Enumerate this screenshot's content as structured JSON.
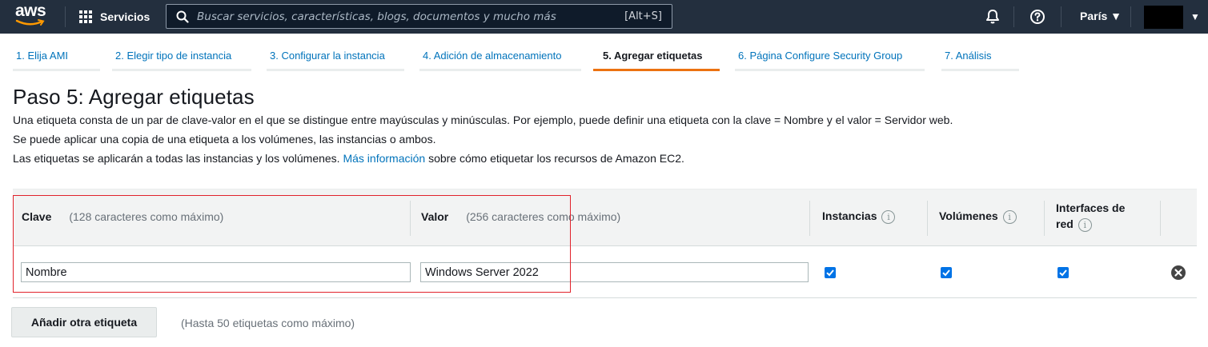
{
  "topnav": {
    "logo_text": "aws",
    "services_label": "Servicios",
    "search_placeholder": "Buscar servicios, características, blogs, documentos y mucho más",
    "search_shortcut": "[Alt+S]",
    "region_label": "París ▼",
    "account_caret": "▼",
    "bg_color": "#232f3e"
  },
  "wizard": {
    "tabs": [
      {
        "label": "1. Elija AMI",
        "active": false
      },
      {
        "label": "2. Elegir tipo de instancia",
        "active": false
      },
      {
        "label": "3. Configurar la instancia",
        "active": false
      },
      {
        "label": "4. Adición de almacenamiento",
        "active": false
      },
      {
        "label": "5. Agregar etiquetas",
        "active": true
      },
      {
        "label": "6. Página Configure Security Group",
        "active": false
      },
      {
        "label": "7. Análisis",
        "active": false
      }
    ],
    "active_color": "#ec7211"
  },
  "page": {
    "title": "Paso 5: Agregar etiquetas",
    "desc1": "Una etiqueta consta de un par de clave-valor en el que se distingue entre mayúsculas y minúsculas. Por ejemplo, puede definir una etiqueta con la clave = Nombre y el valor = Servidor web.",
    "desc2": "Se puede aplicar una copia de una etiqueta a los volúmenes, las instancias o ambos.",
    "desc3_before": "Las etiquetas se aplicarán a todas las instancias y los volúmenes.",
    "desc3_link": "Más información",
    "desc3_after": "sobre cómo etiquetar los recursos de Amazon EC2."
  },
  "table": {
    "headers": {
      "key": "Clave",
      "key_hint": "(128 caracteres como máximo)",
      "value": "Valor",
      "value_hint": "(256 caracteres como máximo)",
      "instances": "Instancias",
      "volumes": "Volúmenes",
      "interfaces_line1": "Interfaces de",
      "interfaces_line2": "red",
      "info_glyph": "i"
    },
    "rows": [
      {
        "key": "Nombre",
        "value": "Windows Server 2022",
        "instances": true,
        "volumes": true,
        "interfaces": true
      }
    ]
  },
  "actions": {
    "add_tag_label": "Añadir otra etiqueta",
    "add_tag_hint": "(Hasta 50 etiquetas como máximo)"
  },
  "colors": {
    "link": "#0073bb",
    "checkbox": "#0073e6",
    "highlight_box": "#e1222b"
  }
}
